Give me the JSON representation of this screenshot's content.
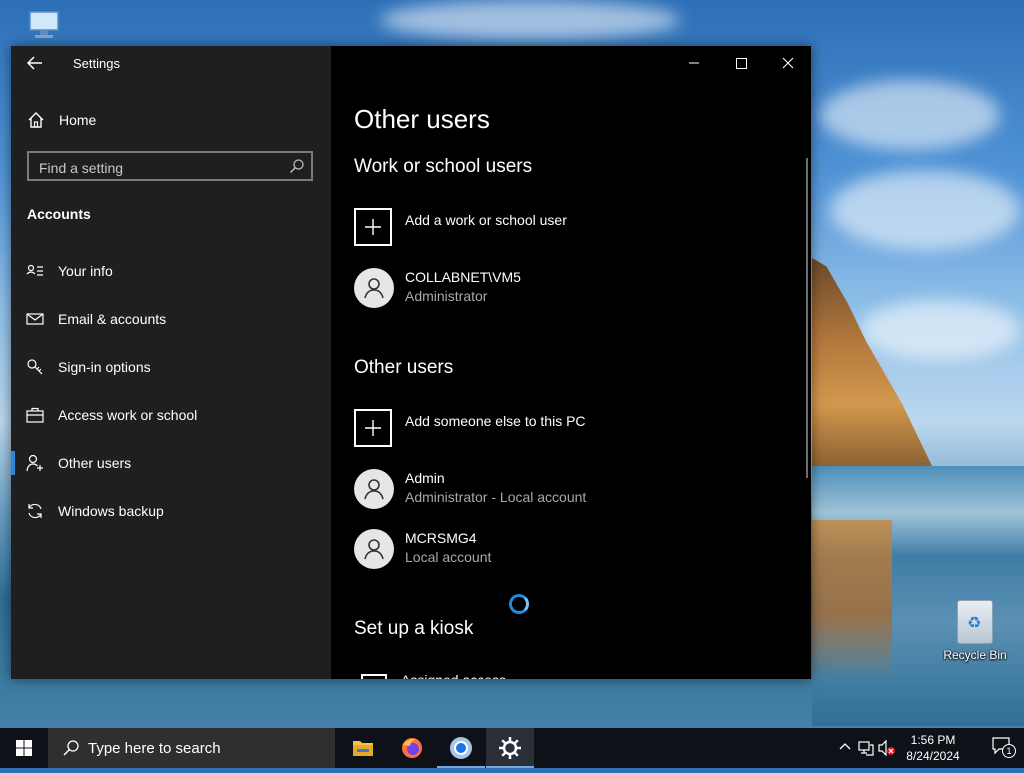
{
  "desktop": {
    "recycle_bin_label": "Recycle Bin"
  },
  "window": {
    "app_title": "Settings",
    "controls": [
      "minimize",
      "maximize",
      "close"
    ]
  },
  "sidebar": {
    "home_label": "Home",
    "search_placeholder": "Find a setting",
    "section_label": "Accounts",
    "items": [
      {
        "label": "Your info",
        "icon": "person-card-icon"
      },
      {
        "label": "Email & accounts",
        "icon": "mail-icon"
      },
      {
        "label": "Sign-in options",
        "icon": "key-icon"
      },
      {
        "label": "Access work or school",
        "icon": "briefcase-icon"
      },
      {
        "label": "Other users",
        "icon": "person-add-icon",
        "active": true
      },
      {
        "label": "Windows backup",
        "icon": "sync-icon"
      }
    ]
  },
  "main": {
    "title": "Other users",
    "work_school": {
      "heading": "Work or school users",
      "add_label": "Add a work or school user",
      "users": [
        {
          "name": "COLLABNET\\VM5",
          "role": "Administrator"
        }
      ]
    },
    "other": {
      "heading": "Other users",
      "add_label": "Add someone else to this PC",
      "users": [
        {
          "name": "Admin",
          "role": "Administrator - Local account"
        },
        {
          "name": "MCRSMG4",
          "role": "Local account"
        }
      ]
    },
    "kiosk": {
      "heading": "Set up a kiosk",
      "partial_label": "Assigned access"
    }
  },
  "taskbar": {
    "search_placeholder": "Type here to search",
    "apps": [
      "file-explorer-icon",
      "firefox-icon",
      "chrome-icon",
      "settings-gear-icon"
    ],
    "time": "1:56 PM",
    "date": "8/24/2024",
    "notification_count": "1"
  },
  "colors": {
    "accent": "#2b88d8",
    "sidebar_bg": "#1f1f1f",
    "main_bg": "#000000",
    "taskbar_bg": "#0e1117"
  }
}
